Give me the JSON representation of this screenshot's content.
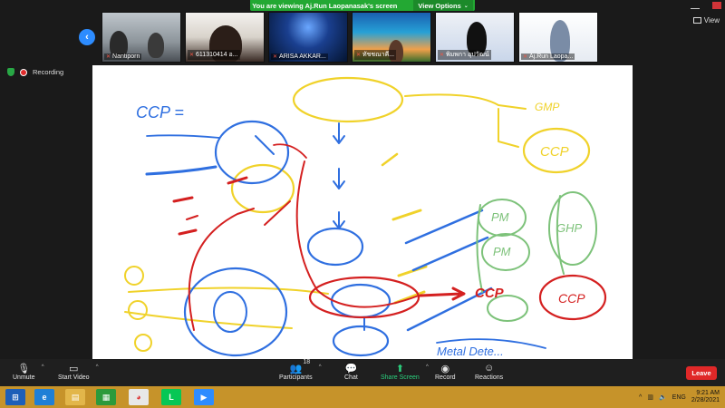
{
  "banner": {
    "viewing_text": "You are viewing Aj.Run Laopanasak's screen",
    "view_options": "View Options"
  },
  "gallery": {
    "participants": [
      {
        "name": "Nantiporn"
      },
      {
        "name": "611310414 อ..."
      },
      {
        "name": "ARISA AKKAR..."
      },
      {
        "name": "ทัชชณาคี..."
      },
      {
        "name": "พิมพกา อุปวัฒน์"
      },
      {
        "name": "Aj.Run Laopa..."
      }
    ],
    "view_label": "View"
  },
  "status": {
    "recording_label": "Recording"
  },
  "whiteboard": {
    "texts": {
      "ccp_eq": "CCP =",
      "gmp": "GMP",
      "ccp_circle": "CCP",
      "ccp_red": "CCP",
      "ccp_red2": "CCP",
      "pm1": "PM",
      "pm2": "PM",
      "ghp": "GHP",
      "metal": "Metal Dete..."
    }
  },
  "toolbar": {
    "unmute": "Unmute",
    "start_video": "Start Video",
    "participants": "Participants",
    "participants_count": "18",
    "chat": "Chat",
    "share_screen": "Share Screen",
    "record": "Record",
    "reactions": "Reactions",
    "leave": "Leave"
  },
  "taskbar": {
    "lang": "ENG",
    "time": "9:21 AM",
    "date": "2/28/2021"
  },
  "colors": {
    "share_green": "#2bd17e",
    "leave_red": "#e02828",
    "banner_green": "#23a833",
    "taskbar": "#c6932a",
    "pen_blue": "#2f6fe0",
    "pen_red": "#d42020",
    "pen_yellow": "#f0d22a",
    "pen_green": "#7dc27a"
  }
}
